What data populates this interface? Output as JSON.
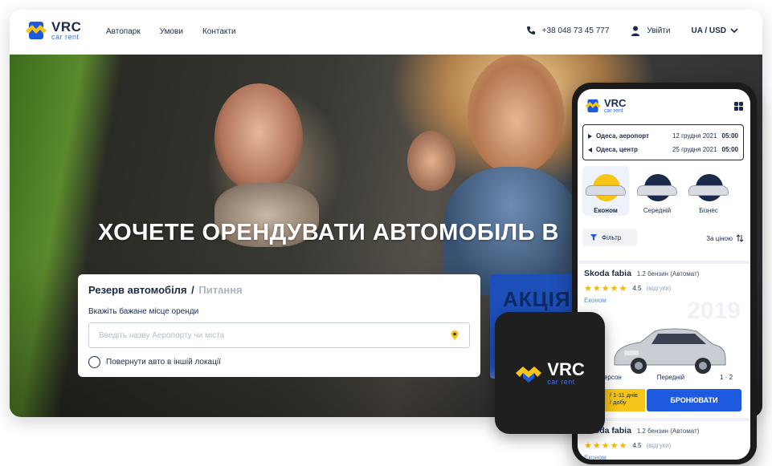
{
  "brand": {
    "name": "VRC",
    "tagline": "car rent",
    "colors": {
      "navy": "#1b2a4a",
      "blue": "#1d5ae0",
      "yellow": "#f5c518"
    }
  },
  "header": {
    "nav": [
      "Автопарк",
      "Умови",
      "Контакти"
    ],
    "phone": "+38 048 73 45 777",
    "login": "Увійти",
    "locale": "UA / USD"
  },
  "hero": {
    "headline": "ХОЧЕТЕ ОРЕНДУВАТИ АВТОМОБІЛЬ В",
    "promo": "АКЦІЯ"
  },
  "booking_form": {
    "tab_active": "Резерв автомобіля",
    "tab_separator": "/",
    "tab_inactive": "Питання",
    "label": "Вкажіть бажане місце оренди",
    "input_placeholder": "Введіть назву Аеропорту чи міста",
    "checkbox_label": "Повернути авто в іншій локації"
  },
  "mobile": {
    "route": [
      {
        "place": "Одеса, аеропорт",
        "date": "12 грудня 2021",
        "time": "05:00"
      },
      {
        "place": "Одеса, центр",
        "date": "25 грудня 2021",
        "time": "05:00"
      }
    ],
    "classes": [
      {
        "name": "Економ",
        "active": true
      },
      {
        "name": "Середній",
        "active": false
      },
      {
        "name": "Бізнес",
        "active": false
      }
    ],
    "filter_label": "Фільтр",
    "sort_label": "За ціною",
    "cards": [
      {
        "name": "Skoda fabia",
        "spec": "1.2 бензин (Автомат)",
        "rating": "4.5",
        "reviews": "(відгуки)",
        "class": "Економ",
        "year": "2019",
        "persons": "5 персон",
        "drive": "Передній",
        "bags_small": "1",
        "bags_large": "2",
        "price_note": "/ 1-11 днів / добу",
        "book": "БРОНЮВАТИ"
      },
      {
        "name": "Skoda fabia",
        "spec": "1.2 бензин (Автомат)",
        "rating": "4.5",
        "reviews": "(відгуки)",
        "class": "Економ"
      }
    ]
  },
  "icons": [
    "phone-icon",
    "user-icon",
    "chevron-down-icon",
    "location-pin-icon",
    "grid-menu-icon",
    "filter-icon",
    "sort-icon",
    "star-icon"
  ]
}
